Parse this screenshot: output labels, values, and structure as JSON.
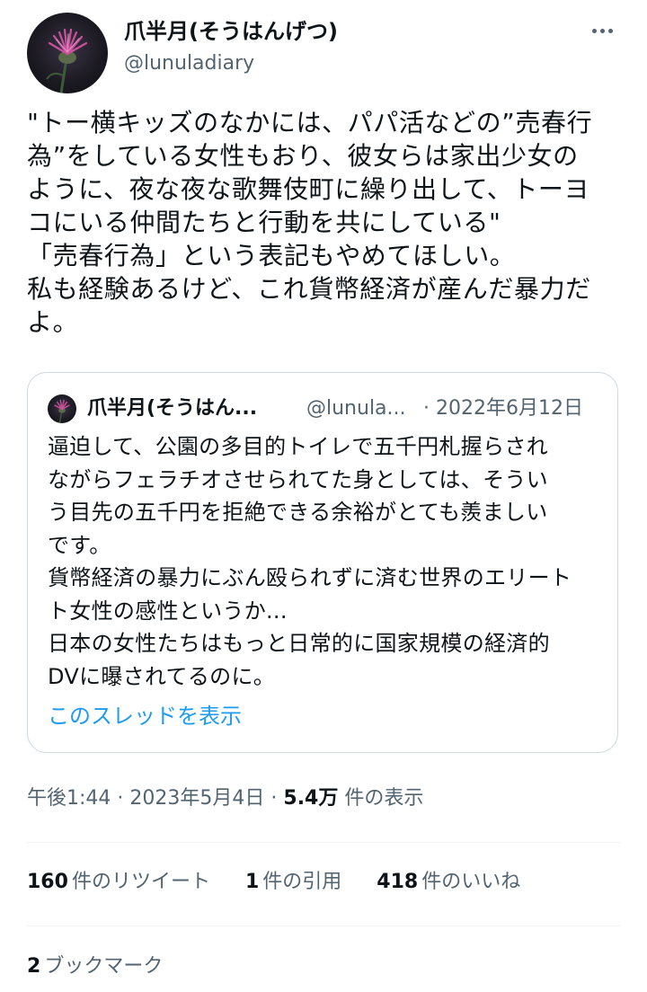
{
  "author": {
    "display_name": "爪半月(そうはんげつ)",
    "handle": "@lunuladiary"
  },
  "tweet": {
    "lines": [
      "\"トー横キッズのなかには、パパ活などの”売春行",
      "為”をしている女性もおり、彼女らは家出少女の",
      "ように、夜な夜な歌舞伎町に繰り出して、トーヨ",
      "コにいる仲間たちと行動を共にしている\"",
      "「売春行為」という表記もやめてほしい。",
      "私も経験あるけど、これ貨幣経済が産んだ暴力だ",
      "よ。"
    ]
  },
  "quote": {
    "display_name": "爪半月(そうはん...",
    "handle": "@lunula...",
    "date": "· 2022年6月12日",
    "lines": [
      "逼迫して、公園の多目的トイレで五千円札握らされ",
      "ながらフェラチオさせられてた身としては、そうい",
      "う目先の五千円を拒絶できる余裕がとても羨ましい",
      "です。",
      "貨幣経済の暴力にぶん殴られずに済む世界のエリート",
      "ト女性の感性というか...",
      "日本の女性たちはもっと日常的に国家規模の経済的",
      "DVに曝されてるのに。"
    ],
    "show_thread": "このスレッドを表示"
  },
  "meta": {
    "time": "午後1:44",
    "date": "2023年5月4日",
    "views_count": "5.4万",
    "views_label": "件の表示",
    "separator": "·"
  },
  "stats": {
    "retweets_count": "160",
    "retweets_label": "件のリツイート",
    "quotes_count": "1",
    "quotes_label": "件の引用",
    "likes_count": "418",
    "likes_label": "件のいいね"
  },
  "bookmarks": {
    "count": "2",
    "label": "ブックマーク"
  },
  "icons": {
    "more": "more-horizontal-icon",
    "avatar": "thistle-flower-avatar"
  },
  "colors": {
    "text": "#0f1419",
    "secondary": "#536471",
    "link": "#1d9bf0",
    "border": "#cfd9de"
  }
}
